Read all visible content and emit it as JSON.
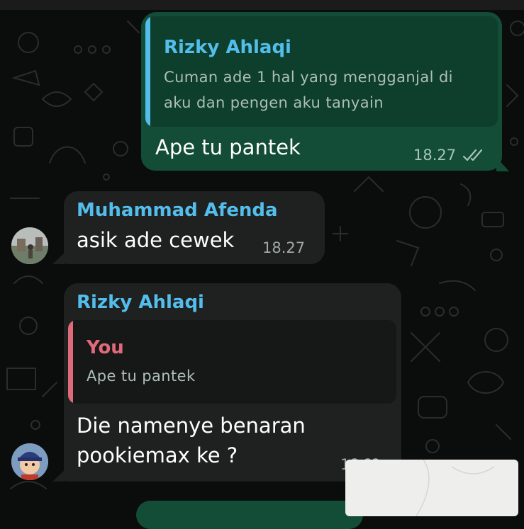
{
  "messages": [
    {
      "direction": "outgoing",
      "reply_to": {
        "sender": "Rizky Ahlaqi",
        "text_line1": "Cuman ade 1 hal yang mengganjal di",
        "text_line2": "aku dan pengen aku tanyain"
      },
      "text": "Ape tu pantek",
      "time": "18.27",
      "status_icon": "double-check-read-icon"
    },
    {
      "direction": "incoming",
      "sender": "Muhammad Afenda",
      "text": "asik ade cewek",
      "time": "18.27",
      "avatar": "avatar-photo-person-outdoors"
    },
    {
      "direction": "incoming",
      "sender": "Rizky Ahlaqi",
      "reply_to": {
        "sender": "You",
        "text": "Ape tu pantek"
      },
      "text_line1": "Die namenye benaran",
      "text_line2": "pookiemax ke ?",
      "time": "18.??",
      "avatar": "avatar-cartoon-character"
    }
  ],
  "colors": {
    "chat_background": "#0b0d0c",
    "outgoing_bubble": "#134d37",
    "incoming_bubble": "#1f2121",
    "sender_blue": "#53bdeb",
    "reply_you_red": "#e06a7a",
    "reply_bar_blue": "#53bdeb"
  }
}
